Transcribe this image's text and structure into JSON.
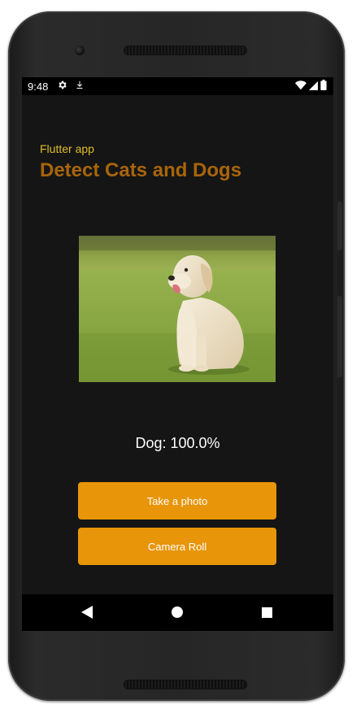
{
  "status_bar": {
    "time": "9:48",
    "icons_left": [
      "settings-icon",
      "download-icon"
    ],
    "icons_right": [
      "wifi-icon",
      "cellular-signal-icon",
      "battery-icon"
    ]
  },
  "app": {
    "subtitle": "Flutter app",
    "title": "Detect Cats and Dogs",
    "result": "Dog: 100.0%",
    "buttons": {
      "take_photo": "Take a photo",
      "camera_roll": "Camera Roll"
    }
  },
  "nav_bar": {
    "icons": [
      "back-icon",
      "home-icon",
      "recents-icon"
    ]
  },
  "colors": {
    "background": "#151515",
    "subtitle": "#e0bd27",
    "title": "#a8650a",
    "button": "#e8950a",
    "button_text": "#ffffff"
  }
}
